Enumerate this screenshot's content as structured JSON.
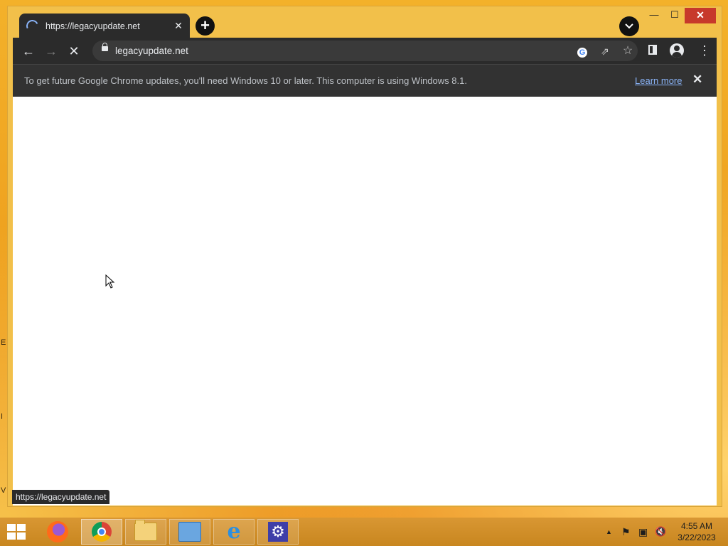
{
  "desktop": {
    "edge_letters": [
      "E",
      "I",
      "V"
    ]
  },
  "browser": {
    "tab": {
      "title": "https://legacyupdate.net",
      "close": "✕"
    },
    "new_tab": "+",
    "tab_search": "⌄",
    "window_controls": {
      "minimize": "—",
      "maximize": "☐",
      "close": "✕"
    },
    "toolbar": {
      "back": "←",
      "forward": "→",
      "stop": "✕"
    },
    "omnibox": {
      "url": "legacyupdate.net"
    },
    "icons": {
      "google": "G",
      "share": "⇗",
      "bookmark": "☆",
      "menu": "⋮"
    },
    "infobar": {
      "message": "To get future Google Chrome updates, you'll need Windows 10 or later. This computer is using Windows 8.1.",
      "link": "Learn more",
      "close": "✕"
    },
    "status_url": "https://legacyupdate.net"
  },
  "taskbar": {
    "apps": [
      "firefox",
      "chrome",
      "file-explorer",
      "control-panel",
      "internet-explorer",
      "settings"
    ],
    "ie_glyph": "e",
    "settings_glyph": "⚙",
    "tray": {
      "up": "▲",
      "flag": "⚑",
      "network": "▣",
      "volume": "🔇"
    },
    "clock": {
      "time": "4:55 AM",
      "date": "3/22/2023"
    }
  }
}
